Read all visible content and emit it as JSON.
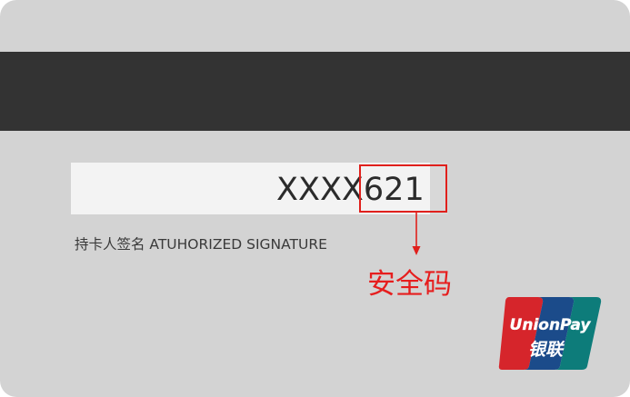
{
  "card": {
    "code_text": "XXXX621",
    "signature_label": "持卡人签名 ATUHORIZED SIGNATURE",
    "annotation_label": "安全码",
    "logo": {
      "name": "unionpay-logo",
      "text_en": "UnionPay",
      "text_cn": "银联"
    }
  },
  "colors": {
    "card_background": "#d3d3d3",
    "stripe": "#333333",
    "highlight": "#e0201c",
    "annotation": "#e61e1e"
  }
}
